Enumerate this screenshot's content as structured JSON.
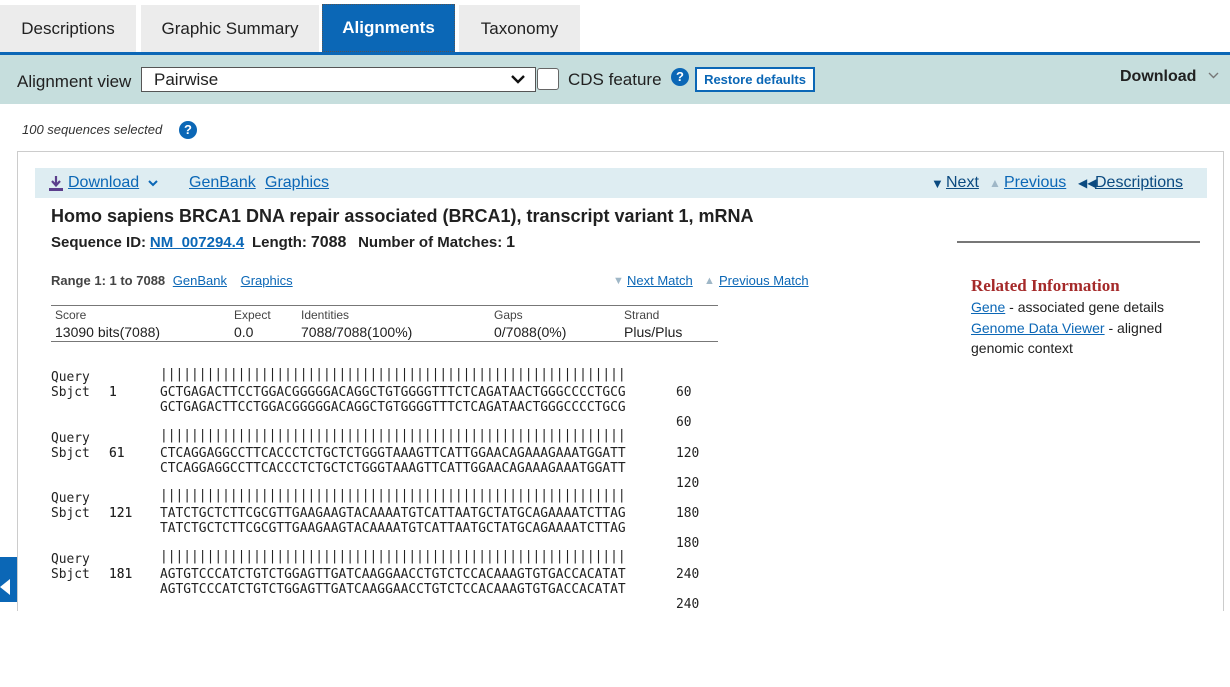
{
  "tabs": [
    "Descriptions",
    "Graphic Summary",
    "Alignments",
    "Taxonomy"
  ],
  "toolbar": {
    "alignment_view_label": "Alignment view",
    "alignment_view_value": "Pairwise",
    "cds_label": "CDS feature",
    "help": "?",
    "restore": "Restore defaults",
    "download": "Download"
  },
  "sequences_selected": "100 sequences selected",
  "hit": {
    "download": "Download",
    "genbank": "GenBank",
    "graphics": "Graphics",
    "next": "Next",
    "previous": "Previous",
    "descriptions": "Descriptions",
    "title": "Homo sapiens BRCA1 DNA repair associated (BRCA1), transcript variant 1, mRNA",
    "seq_id_label": "Sequence ID:",
    "seq_id": "NM_007294.4",
    "length_label": "Length:",
    "length": "7088",
    "matches_label": "Number of Matches:",
    "matches": "1"
  },
  "related": {
    "title": "Related Information",
    "gene_link": "Gene",
    "gene_desc": " - associated gene details",
    "gdv_link": "Genome Data Viewer",
    "gdv_desc": " - aligned genomic context"
  },
  "range": {
    "label": "Range 1: 1 to 7088",
    "genbank": "GenBank",
    "graphics": "Graphics",
    "next_match": "Next Match",
    "previous_match": "Previous Match"
  },
  "stats": {
    "score_h": "Score",
    "score": "13090 bits(7088)",
    "expect_h": "Expect",
    "expect": "0.0",
    "identities_h": "Identities",
    "identities": "7088/7088(100%)",
    "gaps_h": "Gaps",
    "gaps": "0/7088(0%)",
    "strand_h": "Strand",
    "strand": "Plus/Plus"
  },
  "alignment": [
    {
      "q_start": "1",
      "seq": "GCTGAGACTTCCTGGACGGGGGACAGGCTGTGGGGTTTCTCAGATAACTGGGCCCCTGCG",
      "q_end": "60"
    },
    {
      "q_start": "61",
      "seq": "CTCAGGAGGCCTTCACCCTCTGCTCTGGGTAAAGTTCATTGGAACAGAAAGAAATGGATT",
      "q_end": "120"
    },
    {
      "q_start": "121",
      "seq": "TATCTGCTCTTCGCGTTGAAGAAGTACAAAATGTCATTAATGCTATGCAGAAAATCTTAG",
      "q_end": "180"
    },
    {
      "q_start": "181",
      "seq": "AGTGTCCCATCTGTCTGGAGTTGATCAAGGAACCTGTCTCCACAAAGTGTGACCACATAT",
      "q_end": "240"
    }
  ],
  "alignment_labels": {
    "query": "Query",
    "sbjct": "Sbjct"
  }
}
